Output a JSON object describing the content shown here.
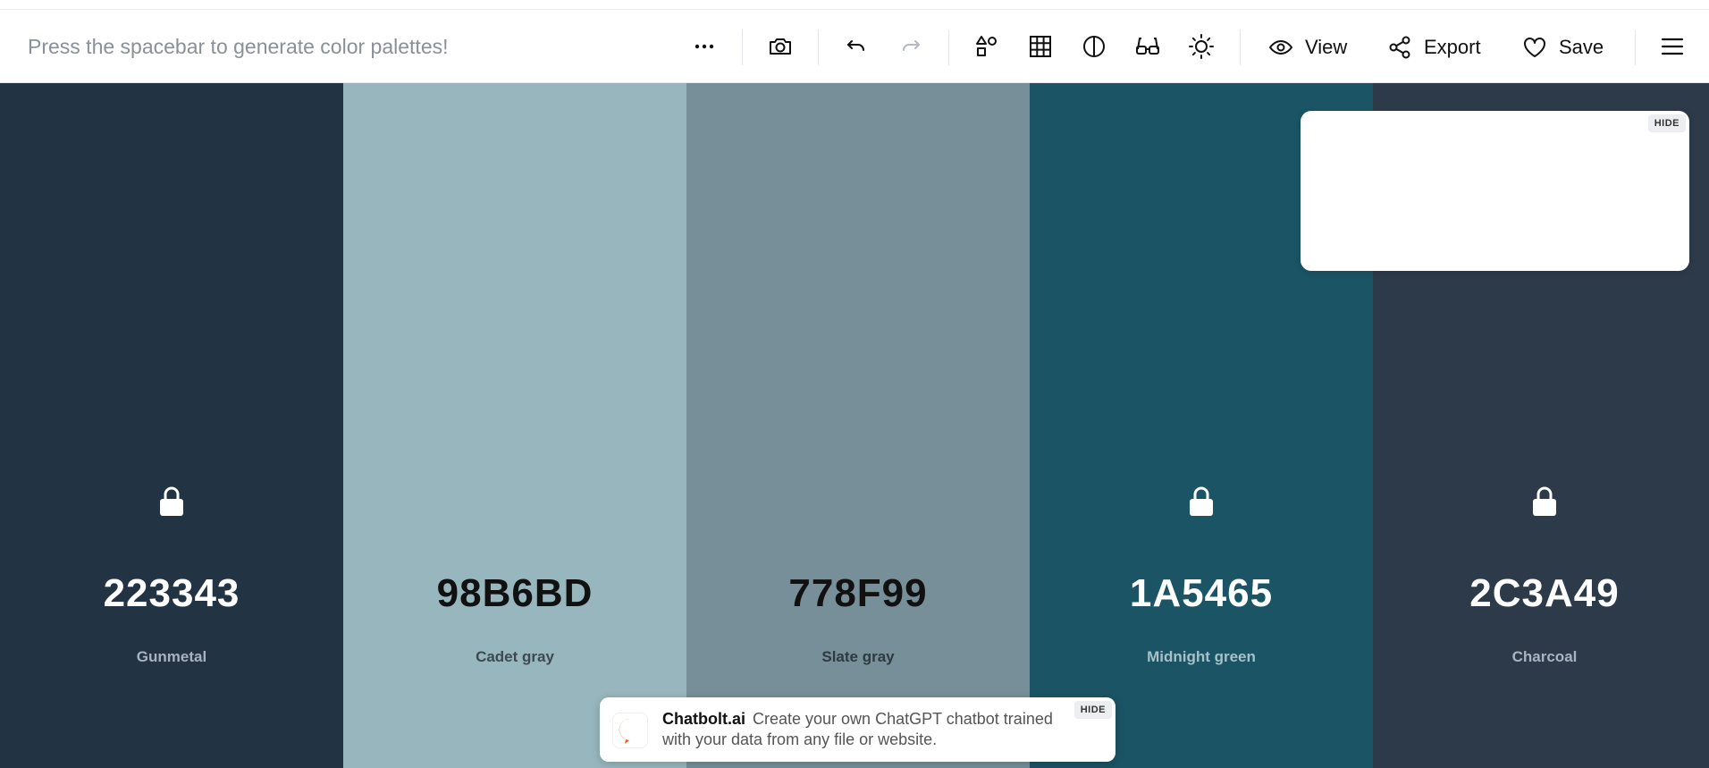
{
  "toolbar": {
    "hint": "Press the spacebar to generate color palettes!",
    "view_label": "View",
    "export_label": "Export",
    "save_label": "Save"
  },
  "swatches": [
    {
      "hex": "223343",
      "name": "Gunmetal",
      "bg": "#223343",
      "fg": "#ffffff",
      "sub": "#a9b3bf",
      "locked": true
    },
    {
      "hex": "98B6BD",
      "name": "Cadet gray",
      "bg": "#98b6bd",
      "fg": "#111111",
      "sub": "#3c4a50",
      "locked": false
    },
    {
      "hex": "778F99",
      "name": "Slate gray",
      "bg": "#778f99",
      "fg": "#111111",
      "sub": "#2e3a40",
      "locked": false
    },
    {
      "hex": "1A5465",
      "name": "Midnight green",
      "bg": "#1a5465",
      "fg": "#ffffff",
      "sub": "#a8c0c8",
      "locked": true
    },
    {
      "hex": "2C3A49",
      "name": "Charcoal",
      "bg": "#2c3a49",
      "fg": "#ffffff",
      "sub": "#aab4c0",
      "locked": true
    }
  ],
  "ad_box": {
    "hide_label": "HIDE"
  },
  "banner": {
    "brand": "Chatbolt.ai",
    "text": "Create your own ChatGPT chatbot trained with your data from any file or website.",
    "hide_label": "HIDE",
    "accent": "#f05a1a"
  }
}
